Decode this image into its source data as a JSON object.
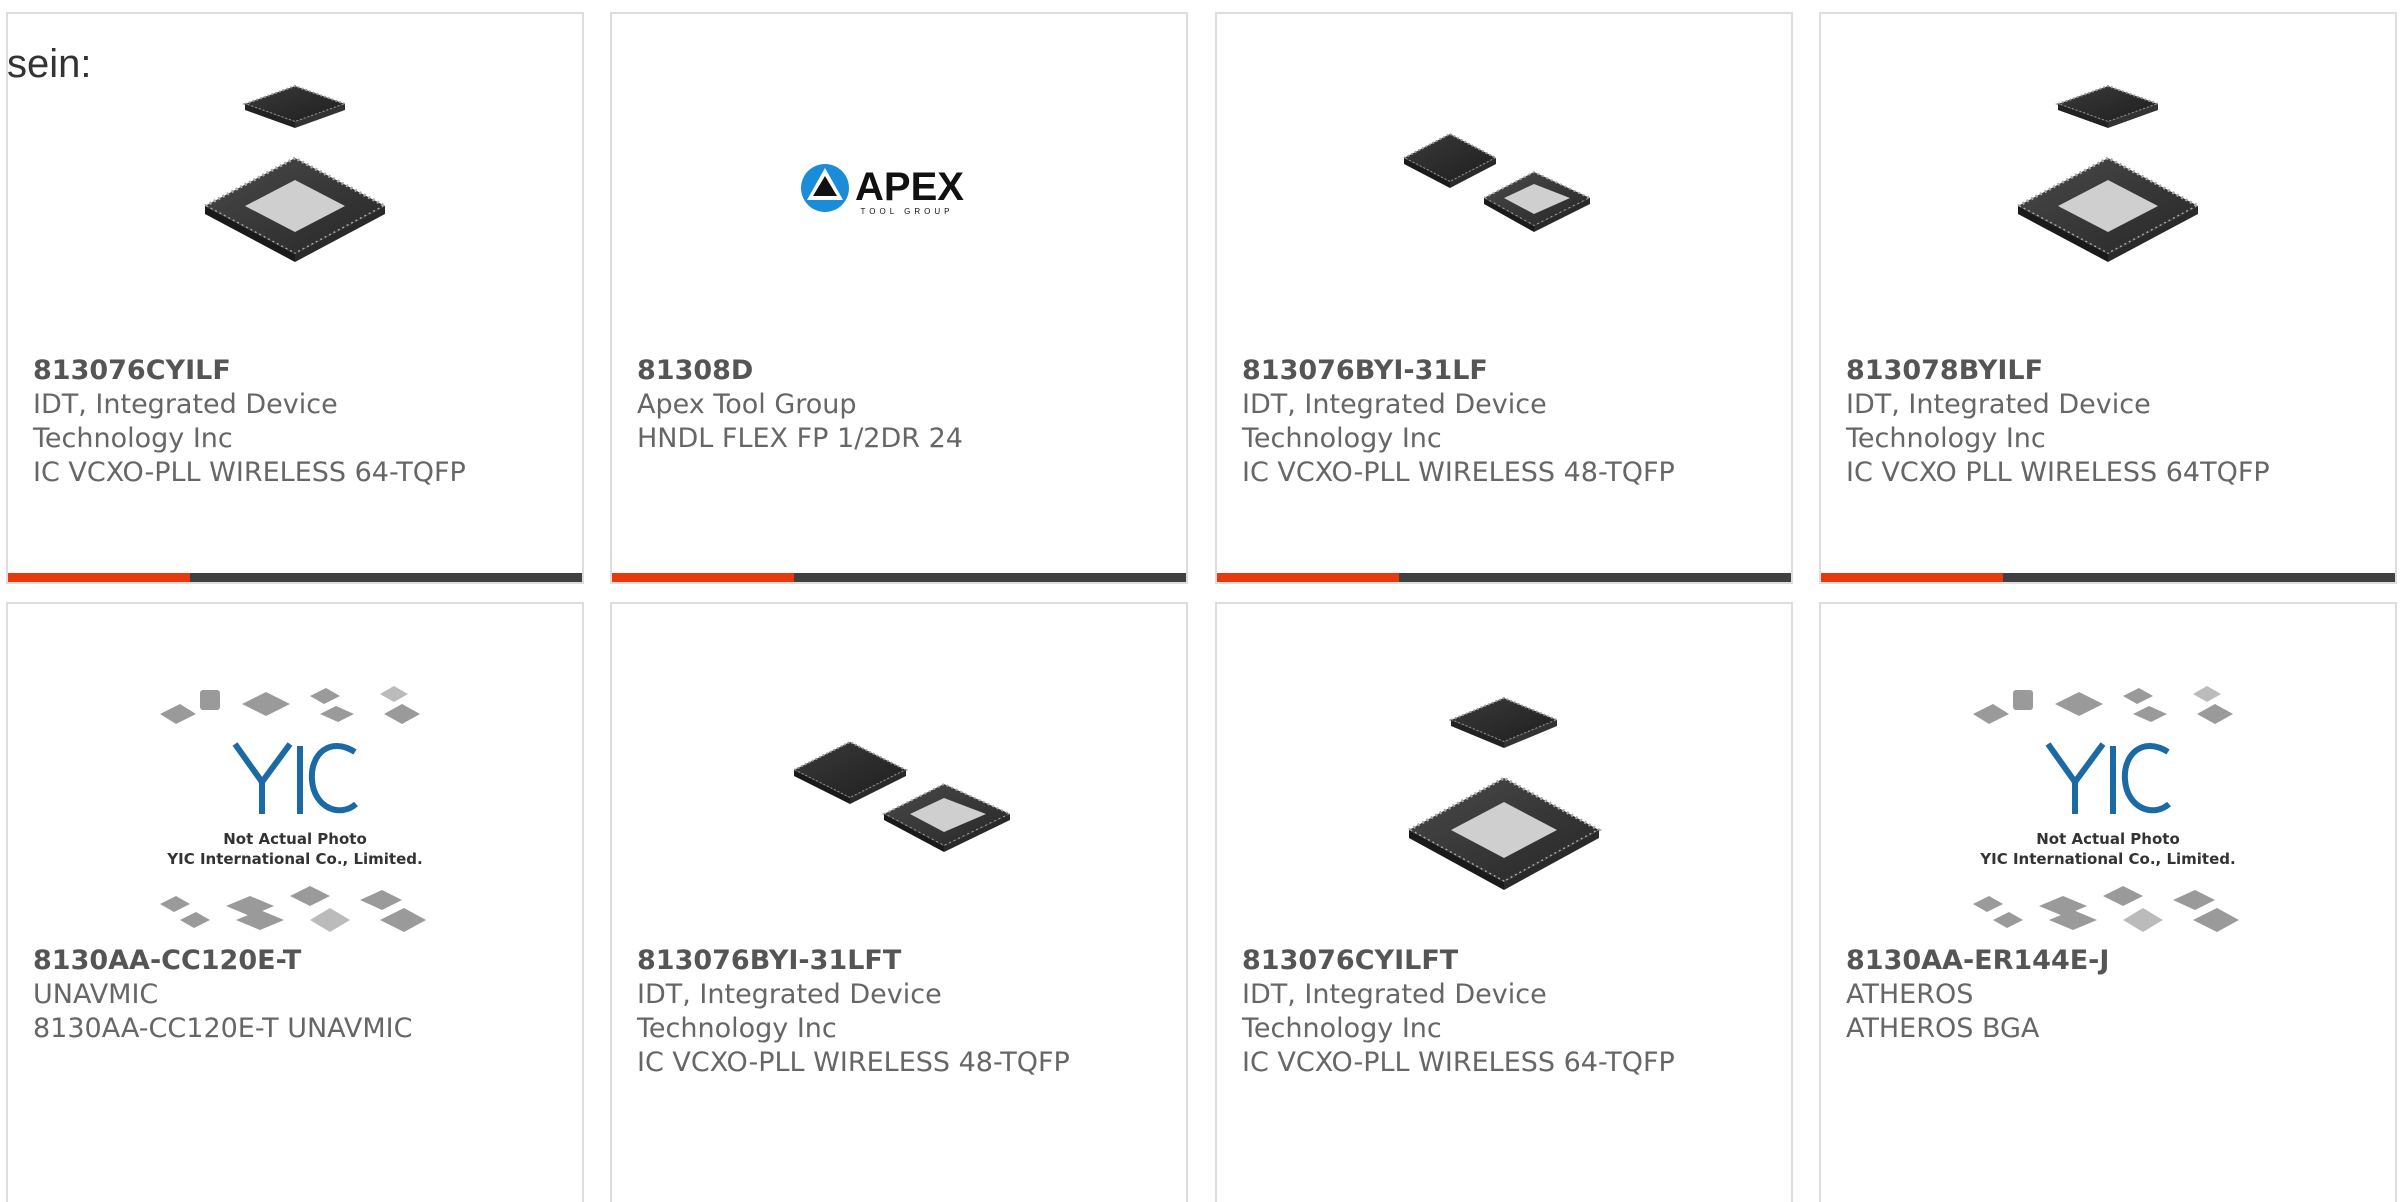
{
  "lead_text": "sein:",
  "colors": {
    "accent": "#e8380d",
    "bar": "#404040",
    "border": "#dddddd",
    "text": "#666666"
  },
  "products": [
    {
      "part": "813076CYILF",
      "manufacturer": "IDT, Integrated Device Technology Inc",
      "description": "IC VCXO-PLL WIRELESS 64-TQFP",
      "image": "chip-pair-large-icon"
    },
    {
      "part": "81308D",
      "manufacturer": "Apex Tool Group",
      "description": "HNDL FLEX FP 1/2DR 24",
      "image": "apex-logo",
      "logo_text": "APEX",
      "logo_subtext": "TOOL GROUP"
    },
    {
      "part": "813076BYI-31LF",
      "manufacturer": "IDT, Integrated Device Technology Inc",
      "description": "IC VCXO-PLL WIRELESS 48-TQFP",
      "image": "chip-pair-side-icon"
    },
    {
      "part": "813078BYILF",
      "manufacturer": "IDT, Integrated Device Technology Inc",
      "description": "IC VCXO PLL WIRELESS 64TQFP",
      "image": "chip-pair-large-icon"
    },
    {
      "part": "8130AA-CC120E-T",
      "manufacturer": "UNAVMIC",
      "description": "8130AA-CC120E-T UNAVMIC",
      "image": "yic-placeholder",
      "placeholder_line1": "Not Actual Photo",
      "placeholder_line2": "YIC International Co., Limited."
    },
    {
      "part": "813076BYI-31LFT",
      "manufacturer": "IDT, Integrated Device Technology Inc",
      "description": "IC VCXO-PLL WIRELESS 48-TQFP",
      "image": "chip-pair-side-icon"
    },
    {
      "part": "813076CYILFT",
      "manufacturer": "IDT, Integrated Device Technology Inc",
      "description": "IC VCXO-PLL WIRELESS 64-TQFP",
      "image": "chip-pair-large-icon"
    },
    {
      "part": "8130AA-ER144E-J",
      "manufacturer": "ATHEROS",
      "description": "ATHEROS BGA",
      "image": "yic-placeholder",
      "placeholder_line1": "Not Actual Photo",
      "placeholder_line2": "YIC International Co., Limited."
    }
  ]
}
